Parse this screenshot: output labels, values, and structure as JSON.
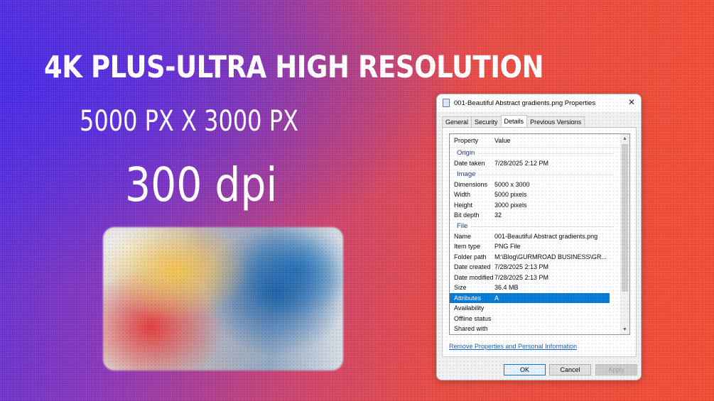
{
  "banner": {
    "headline": "4K PLUS-ULTRA HIGH RESOLUTION",
    "dimensions": "5000 PX X 3000 PX",
    "dpi": "300 dpi"
  },
  "dialog": {
    "title": "001-Beautiful Abstract gradients.png Properties",
    "close_glyph": "✕",
    "tabs": [
      {
        "label": "General"
      },
      {
        "label": "Security"
      },
      {
        "label": "Details",
        "active": true
      },
      {
        "label": "Previous Versions"
      }
    ],
    "columns": {
      "property": "Property",
      "value": "Value"
    },
    "groups": {
      "origin": {
        "label": "Origin",
        "rows": [
          {
            "property": "Date taken",
            "value": "7/28/2025 2:12 PM"
          }
        ]
      },
      "image": {
        "label": "Image",
        "rows": [
          {
            "property": "Dimensions",
            "value": "5000 x 3000"
          },
          {
            "property": "Width",
            "value": "5000 pixels"
          },
          {
            "property": "Height",
            "value": "3000 pixels"
          },
          {
            "property": "Bit depth",
            "value": "32"
          }
        ]
      },
      "file": {
        "label": "File",
        "rows": [
          {
            "property": "Name",
            "value": "001-Beautiful Abstract gradients.png"
          },
          {
            "property": "Item type",
            "value": "PNG File"
          },
          {
            "property": "Folder path",
            "value": "M:\\Blog\\GURMROAD BUSINESS\\GR..."
          },
          {
            "property": "Date created",
            "value": "7/28/2025 2:13 PM"
          },
          {
            "property": "Date modified",
            "value": "7/28/2025 2:13 PM"
          },
          {
            "property": "Size",
            "value": "36.4 MB"
          },
          {
            "property": "Attributes",
            "value": "A"
          },
          {
            "property": "Availability",
            "value": ""
          },
          {
            "property": "Offline status",
            "value": ""
          },
          {
            "property": "Shared with",
            "value": ""
          }
        ]
      }
    },
    "selected_property": "Attributes",
    "remove_link": "Remove Properties and Personal Information",
    "buttons": {
      "ok": "OK",
      "cancel": "Cancel",
      "apply": "Apply"
    },
    "scroll_up_glyph": "▲",
    "scroll_down_glyph": "▼"
  },
  "colors": {
    "selection": "#0078d7",
    "group_label": "#1e3287",
    "link": "#0a5fbf"
  }
}
